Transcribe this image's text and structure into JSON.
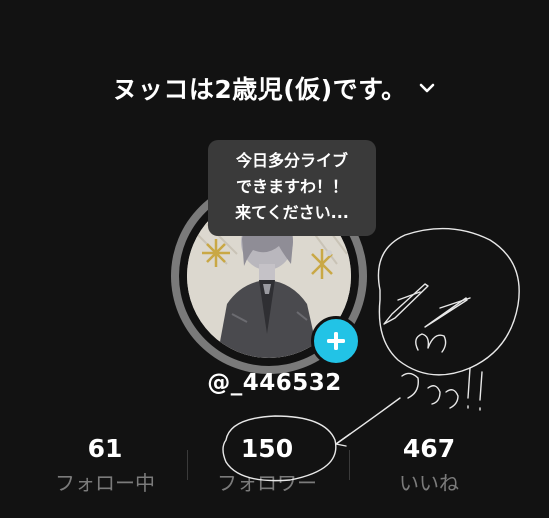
{
  "header": {
    "account_name": "ヌッコは2歳児(仮)です。",
    "dropdown_icon": "chevron-down-icon"
  },
  "tooltip": {
    "lines": [
      "今日多分ライブ",
      "できますわ！！",
      "来てください..."
    ]
  },
  "profile": {
    "handle": "@_446532",
    "add_icon": "plus-icon",
    "accent_color": "#22c3e6"
  },
  "stats": [
    {
      "value": "61",
      "label": "フォロー中"
    },
    {
      "value": "150",
      "label": "フォロワー"
    },
    {
      "value": "467",
      "label": "いいね"
    }
  ],
  "annotation": {
    "handwritten_text": "うっっ!!"
  }
}
